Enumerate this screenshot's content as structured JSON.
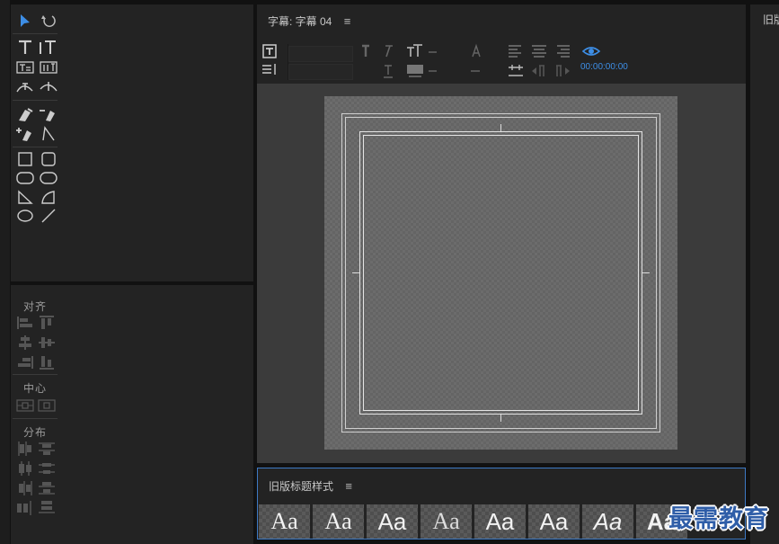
{
  "title_panel": {
    "title": "字幕: 字幕 04",
    "menu_glyph": "≡",
    "timecode": "00:00:00:00"
  },
  "align_panel": {
    "align_label": "对齐",
    "center_label": "中心",
    "distribute_label": "分布"
  },
  "styles_panel": {
    "title": "旧版标题样式",
    "menu_glyph": "≡",
    "swatches": [
      "Aa",
      "Aa",
      "Aa",
      "Aa",
      "Aa",
      "Aa",
      "Aa",
      "Aa"
    ]
  },
  "right_panel": {
    "title": "旧版"
  },
  "watermark": {
    "text": "最需教育"
  },
  "colors": {
    "accent": "#3d8ee6",
    "selection_border": "#3d79c4",
    "panel_bg": "#232323"
  }
}
